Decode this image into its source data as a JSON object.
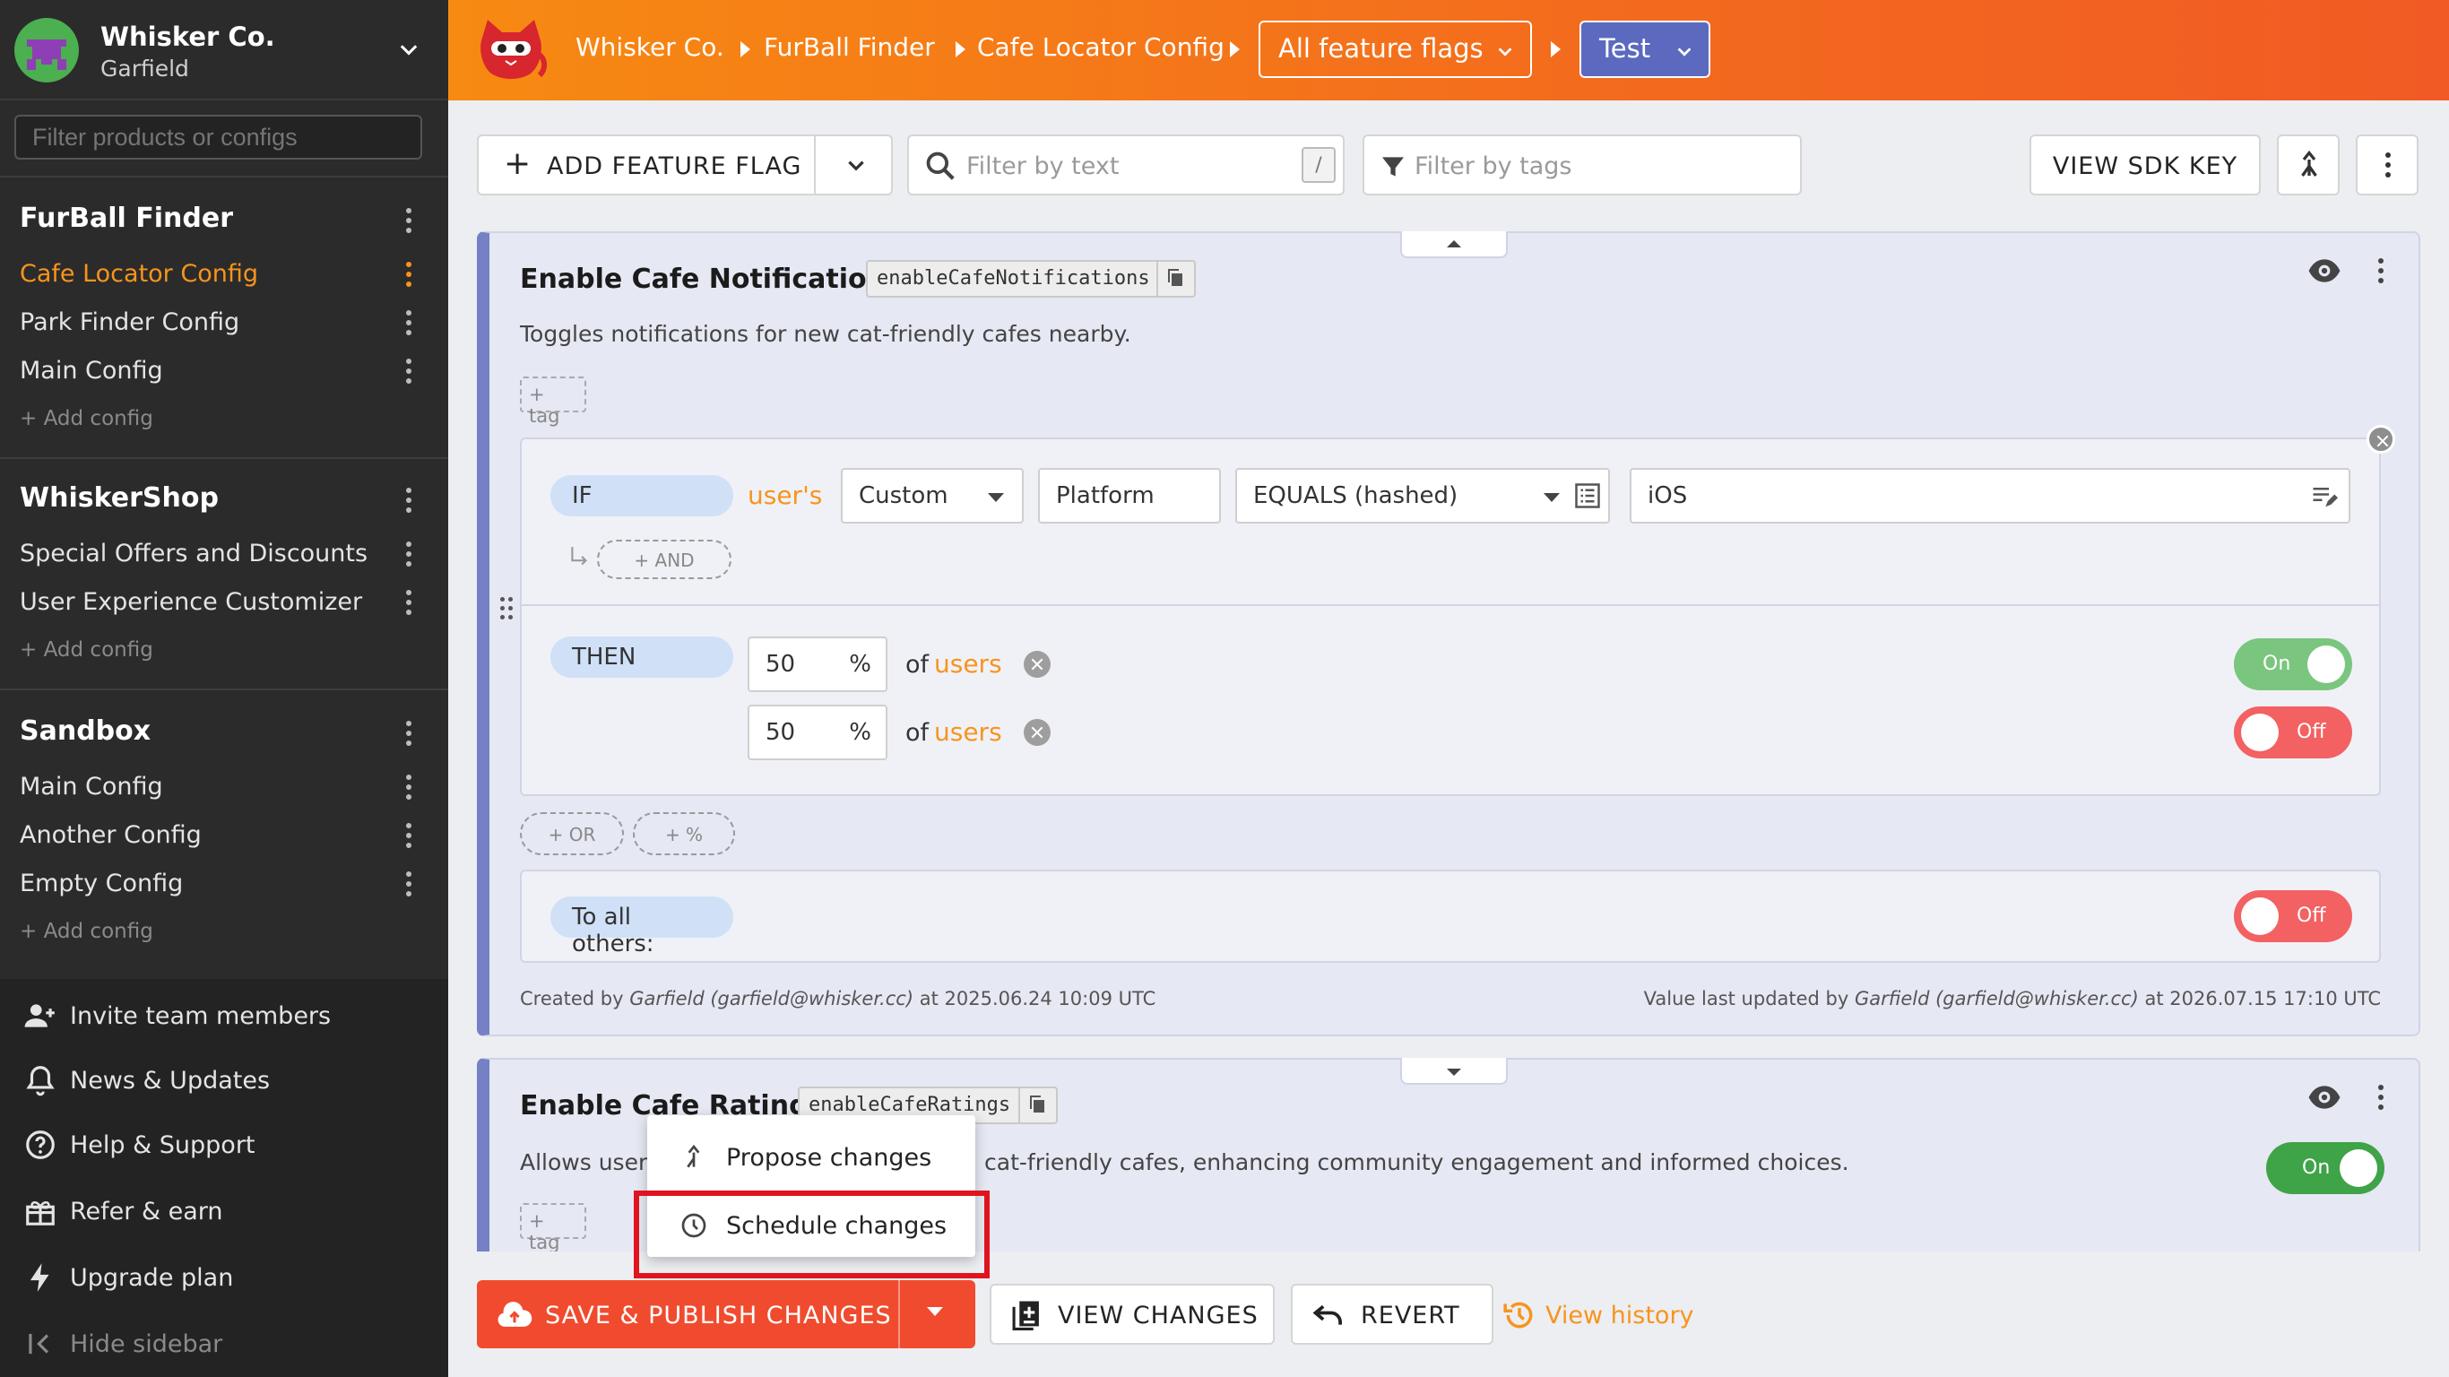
{
  "org": {
    "name": "Whisker Co.",
    "user": "Garfield"
  },
  "sidebar": {
    "filter_placeholder": "Filter products or configs",
    "projects": [
      {
        "title": "FurBall Finder",
        "items": [
          "Cafe Locator Config",
          "Park Finder Config",
          "Main Config"
        ],
        "add": "+ Add config"
      },
      {
        "title": "WhiskerShop",
        "items": [
          "Special Offers and Discounts",
          "User Experience Customizer"
        ],
        "add": "+ Add config"
      },
      {
        "title": "Sandbox",
        "items": [
          "Main Config",
          "Another Config",
          "Empty Config"
        ],
        "add": "+ Add config"
      }
    ],
    "links": {
      "invite": "Invite team members",
      "news": "News & Updates",
      "help": "Help & Support",
      "refer": "Refer & earn",
      "upgrade": "Upgrade plan",
      "hide": "Hide sidebar"
    }
  },
  "topbar": {
    "crumbs": [
      "Whisker Co.",
      "FurBall Finder",
      "Cafe Locator Config"
    ],
    "flag_filter": "All feature flags",
    "environment": "Test"
  },
  "toolbar": {
    "add_flag": "ADD FEATURE FLAG",
    "filter_text_placeholder": "Filter by text",
    "shortcut": "/",
    "filter_tags_placeholder": "Filter by tags",
    "view_sdk_key": "VIEW SDK KEY"
  },
  "flag1": {
    "title": "Enable Cafe Notifications",
    "key": "enableCafeNotifications",
    "description": "Toggles notifications for new cat-friendly cafes nearby.",
    "tag": "+ tag",
    "rule": {
      "if": "IF",
      "users": "user's",
      "attribute_type": "Custom",
      "attribute": "Platform",
      "comparator": "EQUALS (hashed)",
      "value": "iOS",
      "and": "+ AND",
      "then": "THEN",
      "splits": [
        {
          "percent": "50",
          "unit": "%",
          "of": "of",
          "users": "users",
          "toggle": "On"
        },
        {
          "percent": "50",
          "unit": "%",
          "of": "of",
          "users": "users",
          "toggle": "Off"
        }
      ]
    },
    "or_btn": "+ OR",
    "pct_btn": "+ %",
    "others_label": "To all others:",
    "others_toggle": "Off",
    "created": {
      "prefix": "Created by",
      "who": "Garfield (garfield@whisker.cc)",
      "suffix": "at 2025.06.24 10:09 UTC"
    },
    "updated": {
      "prefix": "Value last updated by",
      "who": "Garfield (garfield@whisker.cc)",
      "suffix": "at 2026.07.15 17:10 UTC"
    }
  },
  "flag2": {
    "title": "Enable Cafe Ratings",
    "key": "enableCafeRatings",
    "description_start": "Allows users",
    "description_end": "cat-friendly cafes, enhancing community engagement and informed choices.",
    "tag": "+ tag",
    "toggle": "On"
  },
  "menu": {
    "propose": "Propose changes",
    "schedule": "Schedule changes"
  },
  "actions": {
    "save": "SAVE & PUBLISH CHANGES",
    "view_changes": "VIEW CHANGES",
    "revert": "REVERT",
    "history": "View history"
  },
  "colors": {
    "accent": "#f7941d",
    "topbar": "#f36a1e",
    "flag_border": "#7580c5",
    "env": "#5b6abf",
    "save": "#f04b2e",
    "on": "#7bc67e",
    "off": "#f36163",
    "highlight": "#e0141e"
  }
}
